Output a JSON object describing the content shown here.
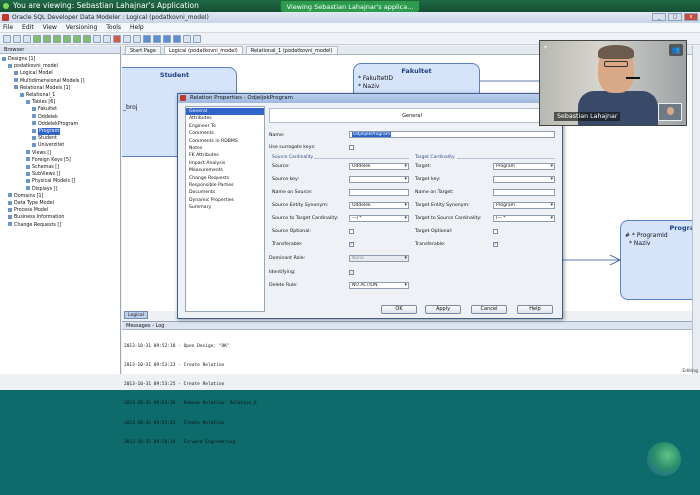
{
  "share": {
    "banner": "You are viewing: Sebastian Lahajnar's Application",
    "tooltip": "Viewing Sebastian Lahajnar's applica..."
  },
  "app": {
    "title": "Oracle SQL Developer Data Modeler : Logical (podatkovni_model)",
    "window_controls": [
      "_",
      "□",
      "x"
    ],
    "menu": [
      "File",
      "Edit",
      "View",
      "Versioning",
      "Tools",
      "Help"
    ]
  },
  "browser": {
    "title": "Browser",
    "tree": [
      {
        "label": "Designs [1]",
        "depth": 0,
        "selected": false
      },
      {
        "label": "podatkovni_model",
        "depth": 1,
        "selected": false
      },
      {
        "label": "Logical Model",
        "depth": 2,
        "selected": false
      },
      {
        "label": "Multidimensional Models []",
        "depth": 2,
        "selected": false
      },
      {
        "label": "Relational Models [1]",
        "depth": 2,
        "selected": false
      },
      {
        "label": "Relational_1",
        "depth": 3,
        "selected": false
      },
      {
        "label": "Tables [6]",
        "depth": 4,
        "selected": false
      },
      {
        "label": "Fakultet",
        "depth": 5,
        "selected": false
      },
      {
        "label": "Oddelek",
        "depth": 5,
        "selected": false
      },
      {
        "label": "OddelekProgram",
        "depth": 5,
        "selected": false
      },
      {
        "label": "Program",
        "depth": 5,
        "selected": true
      },
      {
        "label": "Student",
        "depth": 5,
        "selected": false
      },
      {
        "label": "Univerzitet",
        "depth": 5,
        "selected": false
      },
      {
        "label": "Views []",
        "depth": 4,
        "selected": false
      },
      {
        "label": "Foreign Keys [5]",
        "depth": 4,
        "selected": false
      },
      {
        "label": "Schemas []",
        "depth": 4,
        "selected": false
      },
      {
        "label": "SubViews []",
        "depth": 4,
        "selected": false
      },
      {
        "label": "Physical Models []",
        "depth": 4,
        "selected": false
      },
      {
        "label": "Displays []",
        "depth": 4,
        "selected": false
      },
      {
        "label": "Domains [1]",
        "depth": 1,
        "selected": false
      },
      {
        "label": "Data Type Model",
        "depth": 1,
        "selected": false
      },
      {
        "label": "Process Model",
        "depth": 1,
        "selected": false
      },
      {
        "label": "Business Information",
        "depth": 1,
        "selected": false
      },
      {
        "label": "Change Requests []",
        "depth": 1,
        "selected": false
      }
    ]
  },
  "editor": {
    "tabs": [
      "Start Page",
      "Logical (podatkovni_model)",
      "Relational_1 (podatkovni_model)"
    ],
    "active_tab": 1,
    "bottom_tab": "Logical",
    "entities": {
      "student": {
        "name": "Student",
        "attrs": [
          "_broj"
        ]
      },
      "fakultet": {
        "name": "Fakultet",
        "attrs": [
          "* FakultetID",
          "* Naziv"
        ]
      },
      "program": {
        "name": "Program",
        "attrs": [
          "# * ProgramId",
          "* Naziv"
        ]
      }
    }
  },
  "dialog": {
    "title": "Relation Properties - OdjeljekProgram",
    "nav": [
      "General",
      "Attributes",
      "Engineer To",
      "Comments",
      "Comments in RDBMS",
      "Notes",
      "FK Attributes",
      "Impact Analysis",
      "Measurements",
      "Change Requests",
      "Responsible Parties",
      "Documents",
      "Dynamic Properties",
      "Summary"
    ],
    "active_nav": 0,
    "section": "General",
    "name_label": "Name:",
    "name_value": "OdjeljekProgram",
    "surrogate_label": "Use surrogate keys:",
    "source_group": "Source Cardinality",
    "target_group": "Target Cardinality",
    "source": {
      "source_label": "Source:",
      "source_value": "Oddelek",
      "source_key_label": "Source key:",
      "source_key_value": "",
      "name_on_source_label": "Name on Source:",
      "name_on_source_value": "",
      "synonym_label": "Source Entity Synonym:",
      "synonym_value": "Oddelek",
      "card_label": "Source to Target Cardinality:",
      "card_value": "—I *",
      "optional_label": "Source Optional:",
      "transferable_label": "Transferable:"
    },
    "target": {
      "target_label": "Target:",
      "target_value": "Program",
      "target_key_label": "Target key:",
      "target_key_value": "",
      "name_on_target_label": "Name on Target:",
      "name_on_target_value": "",
      "synonym_label": "Target Entity Synonym:",
      "synonym_value": "Program",
      "card_label": "Target to Source Cardinality:",
      "card_value": "I— *",
      "optional_label": "Target Optional:",
      "transferable_label": "Transferable:"
    },
    "dominant_label": "Dominant Role:",
    "dominant_value": "None",
    "identifying_label": "Identifying:",
    "delete_label": "Delete Rule:",
    "delete_value": "NO ACTION",
    "buttons": {
      "ok": "OK",
      "apply": "Apply",
      "cancel": "Cancel",
      "help": "Help"
    }
  },
  "log": {
    "title": "Messages - Log",
    "lines": [
      "2013-10-31 09:52:18 - Open Design: \"OK\"",
      "2013-10-31 09:53:23 - Create Relation",
      "2013-10-31 09:53:25 - Create Relation",
      "2013-10-31 09:53:38 - Remove Relation: Relation_6",
      "2013-10-31 09:55:42 - Create Relation",
      "2013-10-31 09:56:24 - Forward Engineering"
    ]
  },
  "status": {
    "editing": "Editing"
  },
  "video": {
    "name": "Sebastian Lahajnar"
  }
}
